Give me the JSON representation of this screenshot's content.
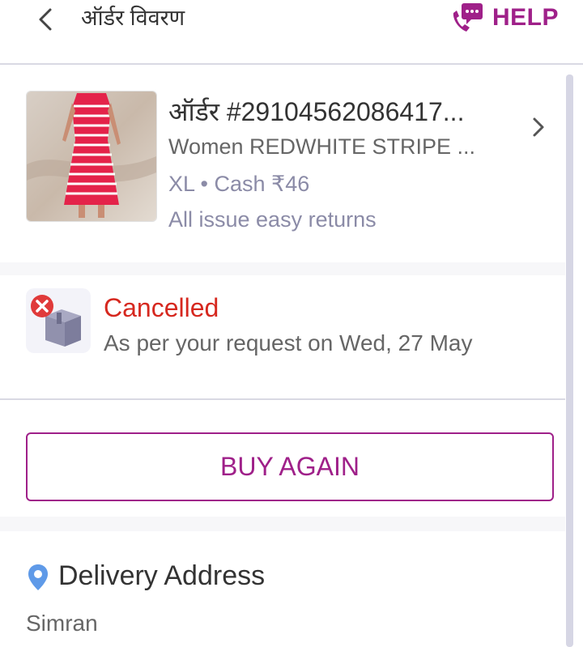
{
  "header": {
    "title": "ऑर्डर विवरण",
    "help_label": "HELP",
    "accent_color": "#9f2089"
  },
  "order": {
    "id_label": "ऑर्डर #29104562086417...",
    "product_name": "Women REDWHITE STRIPE ...",
    "meta": "XL • Cash ₹46",
    "returns": "All issue easy returns"
  },
  "status": {
    "title": "Cancelled",
    "description": "As per your request on Wed, 27 May",
    "color": "#d6281f"
  },
  "actions": {
    "buy_again_label": "BUY AGAIN"
  },
  "delivery": {
    "title": "Delivery Address",
    "name": "Simran"
  },
  "icons": [
    "back-arrow-icon",
    "help-chat-phone-icon",
    "chevron-right-icon",
    "cancelled-box-icon",
    "location-pin-icon"
  ]
}
